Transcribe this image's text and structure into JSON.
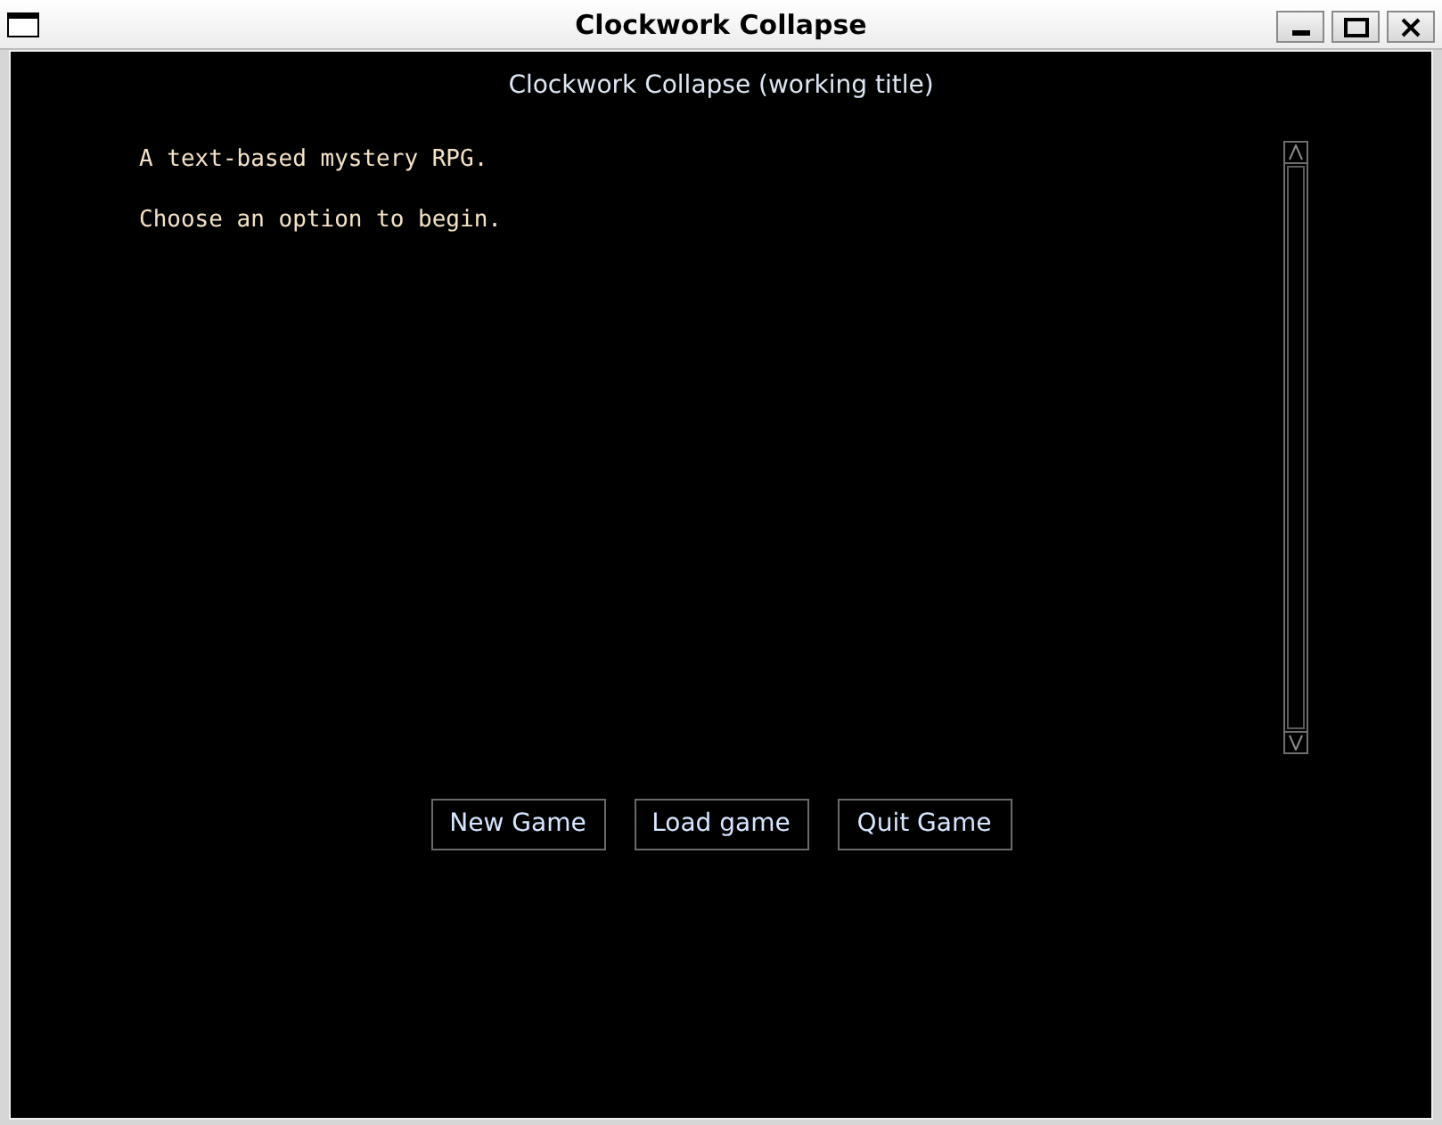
{
  "window": {
    "title": "Clockwork Collapse"
  },
  "header": {
    "title": "Clockwork Collapse (working title)"
  },
  "output": {
    "lines": [
      "A text-based mystery RPG.",
      "Choose an option to begin."
    ]
  },
  "buttons": [
    {
      "label": "New Game"
    },
    {
      "label": "Load game"
    },
    {
      "label": "Quit Game"
    }
  ]
}
